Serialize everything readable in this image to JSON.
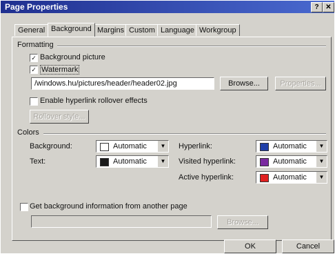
{
  "window": {
    "title": "Page Properties",
    "help_label": "?",
    "close_label": "✕"
  },
  "tabs": [
    "General",
    "Background",
    "Margins",
    "Custom",
    "Language",
    "Workgroup"
  ],
  "formatting": {
    "group_label": "Formatting",
    "background_picture": {
      "label": "Background picture",
      "checked": true
    },
    "watermark": {
      "label": "Watermark",
      "checked": true
    },
    "path_value": "/windows.hu/pictures/header/header02.jpg",
    "browse_label": "Browse...",
    "properties_label": "Properties...",
    "hyperlink_rollover": {
      "label": "Enable hyperlink rollover effects",
      "checked": false
    },
    "rollover_style_label": "Rollover style..."
  },
  "colors": {
    "group_label": "Colors",
    "background": {
      "label": "Background:",
      "value": "Automatic",
      "swatch": "#ffffff"
    },
    "text": {
      "label": "Text:",
      "value": "Automatic",
      "swatch": "#1a1a1a"
    },
    "hyperlink": {
      "label": "Hyperlink:",
      "value": "Automatic",
      "swatch": "#1f3fa8"
    },
    "visited_hyperlink": {
      "label": "Visited hyperlink:",
      "value": "Automatic",
      "swatch": "#7a2aa0"
    },
    "active_hyperlink": {
      "label": "Active hyperlink:",
      "value": "Automatic",
      "swatch": "#e02020"
    }
  },
  "get_background": {
    "label": "Get background information from another page",
    "checked": false,
    "browse_label": "Browse..."
  },
  "footer": {
    "ok_label": "OK",
    "cancel_label": "Cancel"
  }
}
